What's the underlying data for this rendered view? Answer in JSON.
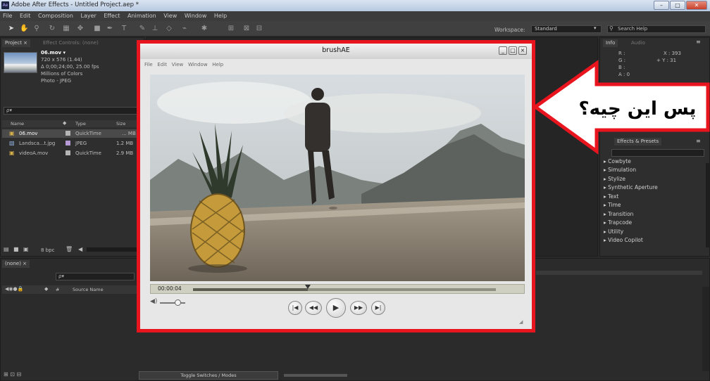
{
  "window": {
    "title": "Adobe After Effects - Untitled Project.aep *",
    "app_icon": "Ae",
    "controls": [
      "–",
      "□",
      "✕"
    ]
  },
  "menubar": [
    "File",
    "Edit",
    "Composition",
    "Layer",
    "Effect",
    "Animation",
    "View",
    "Window",
    "Help"
  ],
  "toolbar": {
    "workspace_label": "Workspace:",
    "workspace_value": "Standard",
    "search_help_placeholder": "Search Help"
  },
  "project_panel": {
    "tab_label": "Project",
    "effect_controls_label": "Effect Controls: (none)",
    "selected_file": {
      "name": "06.mov ▾",
      "dims": "720 x 576 (1.44)",
      "duration": "Δ 0;00;24;00, 25.00 fps",
      "colors": "Millions of Colors",
      "codec": "Photo - JPEG"
    },
    "search_placeholder": "ρ▾",
    "columns": [
      "Name",
      "Type",
      "Size"
    ],
    "rows": [
      {
        "name": "06.mov",
        "type": "QuickTime",
        "size": "... MB"
      },
      {
        "name": "Landsca...t.jpg",
        "type": "JPEG",
        "size": "1.2 MB"
      },
      {
        "name": "videoA.mov",
        "type": "QuickTime",
        "size": "2.9 MB"
      }
    ],
    "bpc": "8 bpc"
  },
  "timeline": {
    "tab_label": "(none)",
    "search_placeholder": "ρ▾",
    "source_name_header": "Source Name",
    "toggle_label": "Toggle Switches / Modes"
  },
  "info_panel": {
    "tabs": [
      "Info",
      "Audio"
    ],
    "r": "R :",
    "g": "G :",
    "b": "B :",
    "a": "A : 0",
    "x": "X : 393",
    "y": "+ Y : 31"
  },
  "effects_panel": {
    "tab_label": "Effects & Presets",
    "items": [
      "Cowbyte",
      "Simulation",
      "Stylize",
      "Synthetic Aperture",
      "Text",
      "Time",
      "Transition",
      "Trapcode",
      "Utility",
      "Video Copilot"
    ]
  },
  "player": {
    "title": "brushAE",
    "menu": [
      "File",
      "Edit",
      "View",
      "Window",
      "Help"
    ],
    "timecode": "00:00:04",
    "progress_fraction": 0.38,
    "volume_fraction": 0.7,
    "buttons": [
      "|◀",
      "◀◀",
      "▶",
      "▶▶",
      "▶|"
    ]
  },
  "callout": {
    "text": "پس این چیه؟",
    "fill_color": "#ffffff",
    "border_color": "#e8141e"
  }
}
